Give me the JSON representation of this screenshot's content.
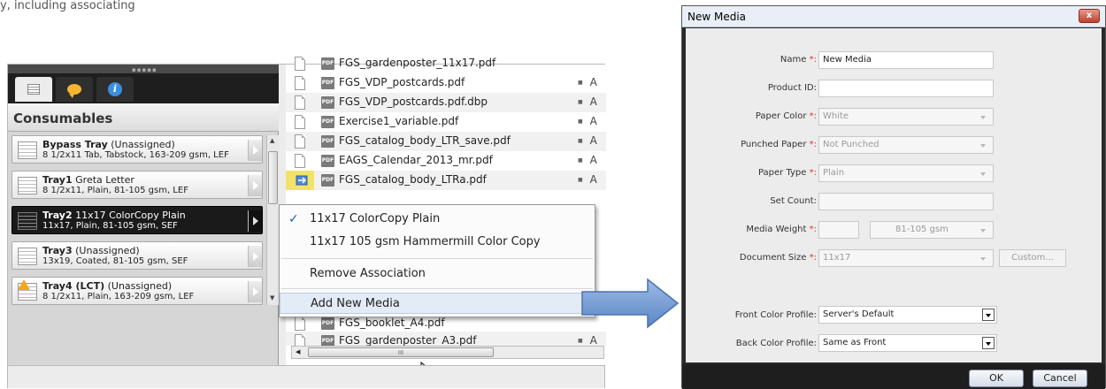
{
  "top_text": "y, including associating",
  "consumables": {
    "heading": "Consumables",
    "trays": [
      {
        "name": "Bypass Tray",
        "status": "(Unassigned)",
        "detail": "8 1/2x11 Tab, Tabstock, 163-209 gsm, LEF",
        "selected": false,
        "warning": false
      },
      {
        "name": "Tray1",
        "status": "Greta Letter",
        "detail": "8 1/2x11, Plain, 81-105 gsm, LEF",
        "selected": false,
        "warning": false
      },
      {
        "name": "Tray2",
        "status": "11x17 ColorCopy Plain",
        "detail": "11x17, Plain, 81-105 gsm, SEF",
        "selected": true,
        "warning": false
      },
      {
        "name": "Tray3",
        "status": "(Unassigned)",
        "detail": "13x19, Coated, 81-105 gsm, SEF",
        "selected": false,
        "warning": false
      },
      {
        "name": "Tray4 (LCT)",
        "status": "(Unassigned)",
        "detail": "8 1/2x11, Plain, 163-209 gsm, LEF",
        "selected": false,
        "warning": true
      }
    ]
  },
  "files": {
    "top_partial": "FGS_gardenposter_11x17.pdf",
    "rows": [
      {
        "name": "FGS_VDP_postcards.pdf",
        "col": "A"
      },
      {
        "name": "FGS_VDP_postcards.pdf.dbp",
        "col": "A"
      },
      {
        "name": "Exercise1_variable.pdf",
        "col": "A"
      },
      {
        "name": "FGS_catalog_body_LTR_save.pdf",
        "col": "A"
      },
      {
        "name": "EAGS_Calendar_2013_mr.pdf",
        "col": "A"
      },
      {
        "name": "FGS_catalog_body_LTRa.pdf",
        "col": "A"
      }
    ],
    "under_menu_1": "FGS_booklet_A4.pdf",
    "under_menu_2": "FGS_gardenposter_A3.pdf",
    "under_menu_2_col": "A",
    "file_icon_label": "PDF"
  },
  "context_menu": {
    "items": [
      {
        "label": "11x17 ColorCopy Plain",
        "checked": true
      },
      {
        "label": "11x17 105 gsm Hammermill Color Copy",
        "checked": false
      }
    ],
    "remove": "Remove Association",
    "add": "Add New Media"
  },
  "dialog": {
    "title": "New Media",
    "close": "x",
    "required_mark": "*:",
    "labels": {
      "name": "Name",
      "product_id": "Product ID:",
      "paper_color": "Paper Color",
      "punched": "Punched Paper",
      "paper_type": "Paper Type",
      "set_count": "Set Count:",
      "media_weight": "Media Weight",
      "doc_size": "Document Size",
      "front_profile": "Front Color Profile:",
      "back_profile": "Back Color Profile:"
    },
    "values": {
      "name": "New Media",
      "product_id": "",
      "paper_color": "White",
      "punched": "Not Punched",
      "paper_type": "Plain",
      "set_count": "",
      "media_weight": "",
      "weight_range": "81-105 gsm",
      "doc_size": "11x17",
      "front_profile": "Server's Default",
      "back_profile": "Same as Front"
    },
    "custom_button": "Custom...",
    "ok": "OK",
    "cancel": "Cancel"
  },
  "colors": {
    "selected_tray": "#1a1a1a",
    "arrow": "#6f9ad6",
    "required": "#dd3333",
    "file_highlight": "#f3e26a"
  }
}
